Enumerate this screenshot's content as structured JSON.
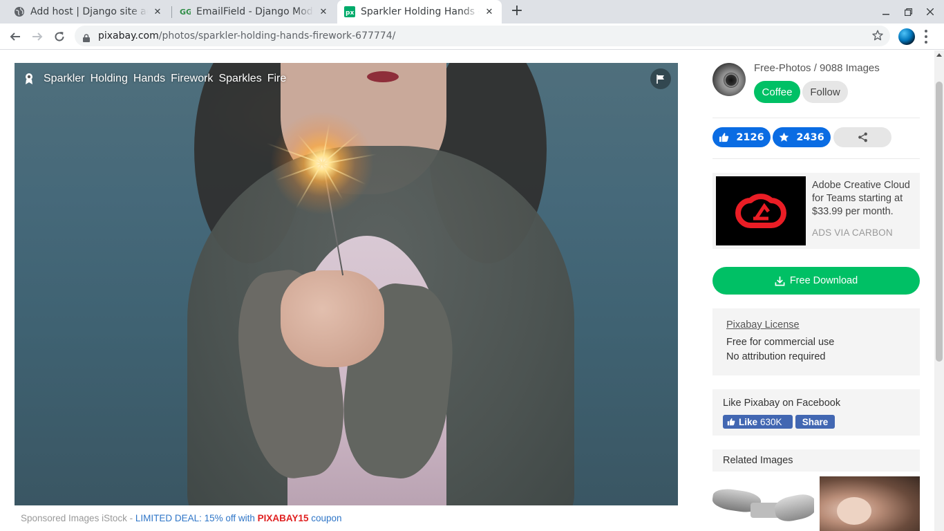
{
  "browser": {
    "tabs": [
      {
        "title": "Add host | Django site admin",
        "icon": "globe-icon",
        "active": false
      },
      {
        "title": "EmailField - Django Models",
        "icon": "gfg-logo-icon",
        "active": false
      },
      {
        "title": "Sparkler Holding Hands - Free",
        "icon": "pixabay-logo-icon",
        "active": true
      }
    ],
    "url_host": "pixabay.com",
    "url_path": "/photos/sparkler-holding-hands-firework-677774/"
  },
  "photo": {
    "tags": [
      "Sparkler",
      "Holding",
      "Hands",
      "Firework",
      "Sparkles",
      "Fire"
    ],
    "sponsored_prefix": "Sponsored Images iStock - ",
    "sponsored_deal": "LIMITED DEAL: 15% off with ",
    "sponsored_code": "PIXABAY15",
    "sponsored_suffix": " coupon"
  },
  "sidebar": {
    "author": "Free-Photos / 9088 Images",
    "coffee_label": "Coffee",
    "follow_label": "Follow",
    "likes": "2126",
    "favorites": "2436",
    "ad": {
      "text": "Adobe Creative Cloud for Teams starting at $33.99 per month.",
      "via": "ADS VIA CARBON"
    },
    "download_label": "Free Download",
    "license": {
      "link": "Pixabay License",
      "line1": "Free for commercial use",
      "line2": "No attribution required"
    },
    "facebook": {
      "label": "Like Pixabay on Facebook",
      "like": "Like",
      "count": "630K",
      "share": "Share"
    },
    "related_label": "Related Images"
  },
  "colors": {
    "accent_green": "#00c065",
    "accent_blue": "#0a6ce3",
    "facebook_blue": "#4267b2",
    "coupon_red": "#e02020"
  }
}
